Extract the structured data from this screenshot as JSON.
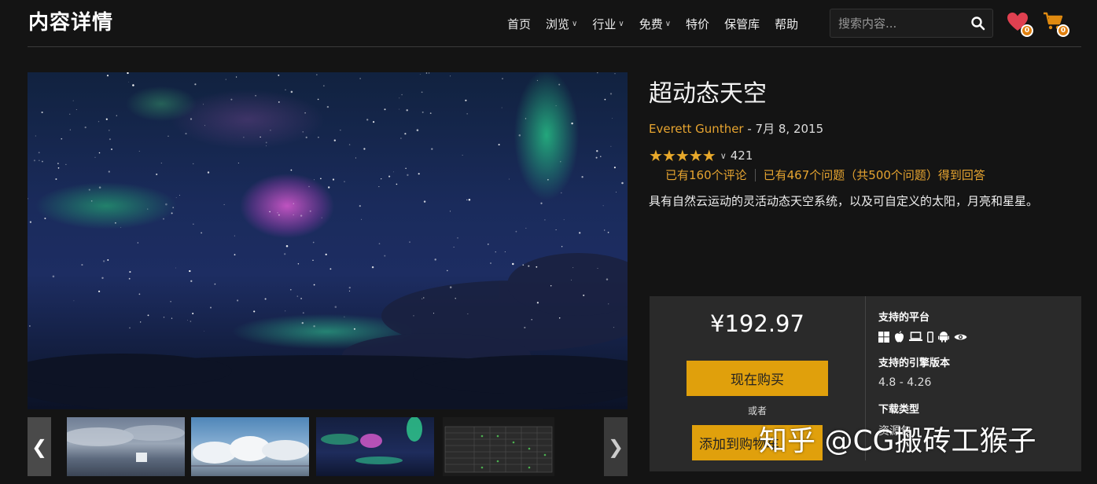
{
  "header": {
    "site_title": "内容详情",
    "nav": [
      {
        "label": "首页",
        "dropdown": false
      },
      {
        "label": "浏览",
        "dropdown": true
      },
      {
        "label": "行业",
        "dropdown": true
      },
      {
        "label": "免费",
        "dropdown": true
      },
      {
        "label": "特价",
        "dropdown": false
      },
      {
        "label": "保管库",
        "dropdown": false
      },
      {
        "label": "帮助",
        "dropdown": false
      }
    ],
    "search_placeholder": "搜索内容...",
    "wishlist_count": "0",
    "cart_count": "0"
  },
  "product": {
    "title": "超动态天空",
    "author": "Everett Gunther",
    "date": " - 7月 8, 2015",
    "rating_stars": 5,
    "rating_count": "421",
    "reviews_link": "已有160个评论",
    "questions_link": "已有467个问题（共500个问题）得到回答",
    "description": "具有自然云运动的灵活动态天空系统，以及可自定义的太阳，月亮和星星。"
  },
  "purchase": {
    "price": "¥192.97",
    "buy_now": "现在购买",
    "or": "或者",
    "add_to_cart": "添加到购物车"
  },
  "specs": {
    "platforms_label": "支持的平台",
    "platform_icons": [
      "windows-icon",
      "apple-icon",
      "laptop-icon",
      "mobile-icon",
      "android-icon",
      "eye-icon"
    ],
    "engine_label": "支持的引擎版本",
    "engine_versions": "4.8 - 4.26",
    "download_type_label": "下载类型",
    "download_type_value": "资源包"
  },
  "gallery": {
    "thumbnails": [
      "thumb-cloudy-sky",
      "thumb-cumulus-clouds",
      "thumb-aurora",
      "thumb-features-table"
    ]
  },
  "watermark": "知乎 @CG搬砖工猴子",
  "colors": {
    "accent": "#e0a00c",
    "link": "#e6a430",
    "background": "#141414",
    "panel": "#2a2a2a",
    "badge": "#e08010",
    "wishlist": "#e04050"
  }
}
